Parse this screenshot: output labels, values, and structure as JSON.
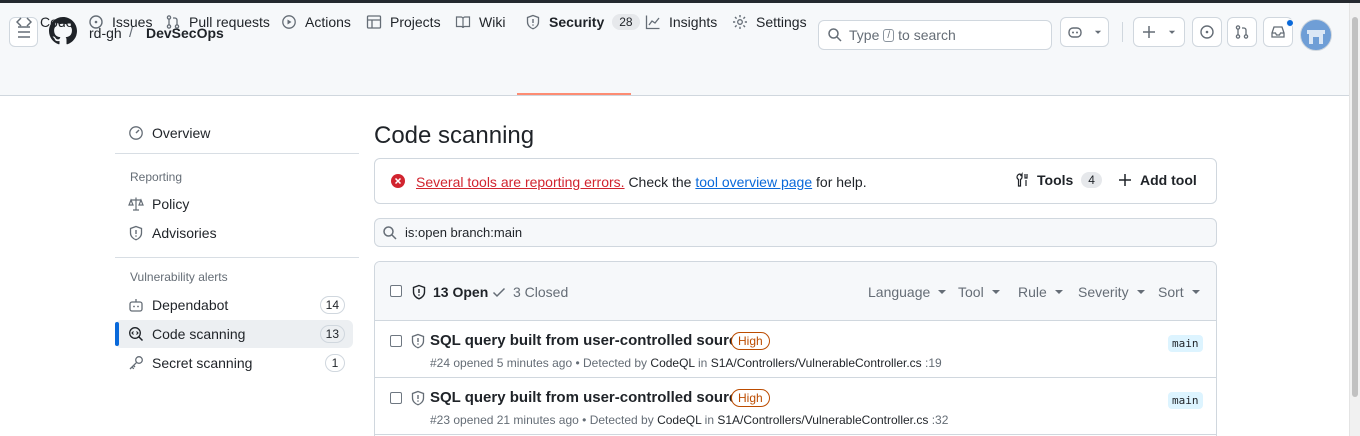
{
  "header": {
    "owner": "rd-gh",
    "separator": "/",
    "repo": "DevSecOps",
    "search": {
      "pre": "Type",
      "key": "/",
      "post": "to search"
    }
  },
  "tabs": [
    {
      "label": "Code",
      "icon": "code-icon"
    },
    {
      "label": "Issues",
      "icon": "issue-opened-icon"
    },
    {
      "label": "Pull requests",
      "icon": "git-pull-request-icon"
    },
    {
      "label": "Actions",
      "icon": "play-icon"
    },
    {
      "label": "Projects",
      "icon": "table-icon"
    },
    {
      "label": "Wiki",
      "icon": "book-icon"
    },
    {
      "label": "Security",
      "icon": "shield-icon",
      "count": "28",
      "selected": true
    },
    {
      "label": "Insights",
      "icon": "graph-icon"
    },
    {
      "label": "Settings",
      "icon": "gear-icon"
    }
  ],
  "sidebar": {
    "overview": "Overview",
    "reporting_heading": "Reporting",
    "policy": "Policy",
    "advisories": "Advisories",
    "vuln_heading": "Vulnerability alerts",
    "dependabot": {
      "label": "Dependabot",
      "count": "14"
    },
    "code_scanning": {
      "label": "Code scanning",
      "count": "13"
    },
    "secret_scanning": {
      "label": "Secret scanning",
      "count": "1"
    }
  },
  "page": {
    "title": "Code scanning",
    "flash": {
      "error_link": "Several tools are reporting errors.",
      "text1": "Check the",
      "link": "tool overview page",
      "text2": "for help.",
      "tools_label": "Tools",
      "tools_count": "4",
      "add_tool": "Add tool"
    },
    "filter": "is:open branch:main"
  },
  "results": {
    "open": "13 Open",
    "closed": "3 Closed",
    "menus": [
      "Language",
      "Tool",
      "Rule",
      "Severity",
      "Sort"
    ],
    "rows": [
      {
        "title": "SQL query built from user-controlled sources",
        "severity": "High",
        "number": "#24",
        "opened": "opened 5 minutes ago",
        "detected": "• Detected by",
        "tool": "CodeQL",
        "in": "in",
        "path": "S1A/Controllers/VulnerableController.cs",
        "line": ":19",
        "branch": "main"
      },
      {
        "title": "SQL query built from user-controlled sources",
        "severity": "High",
        "number": "#23",
        "opened": "opened 21 minutes ago",
        "detected": "• Detected by",
        "tool": "CodeQL",
        "in": "in",
        "path": "S1A/Controllers/VulnerableController.cs",
        "line": ":32",
        "branch": "main"
      }
    ]
  },
  "colors": {
    "accent": "#0969da",
    "tab_underline": "#fd8c73",
    "error": "#d1242f",
    "severity_high": "#bc4c00"
  }
}
